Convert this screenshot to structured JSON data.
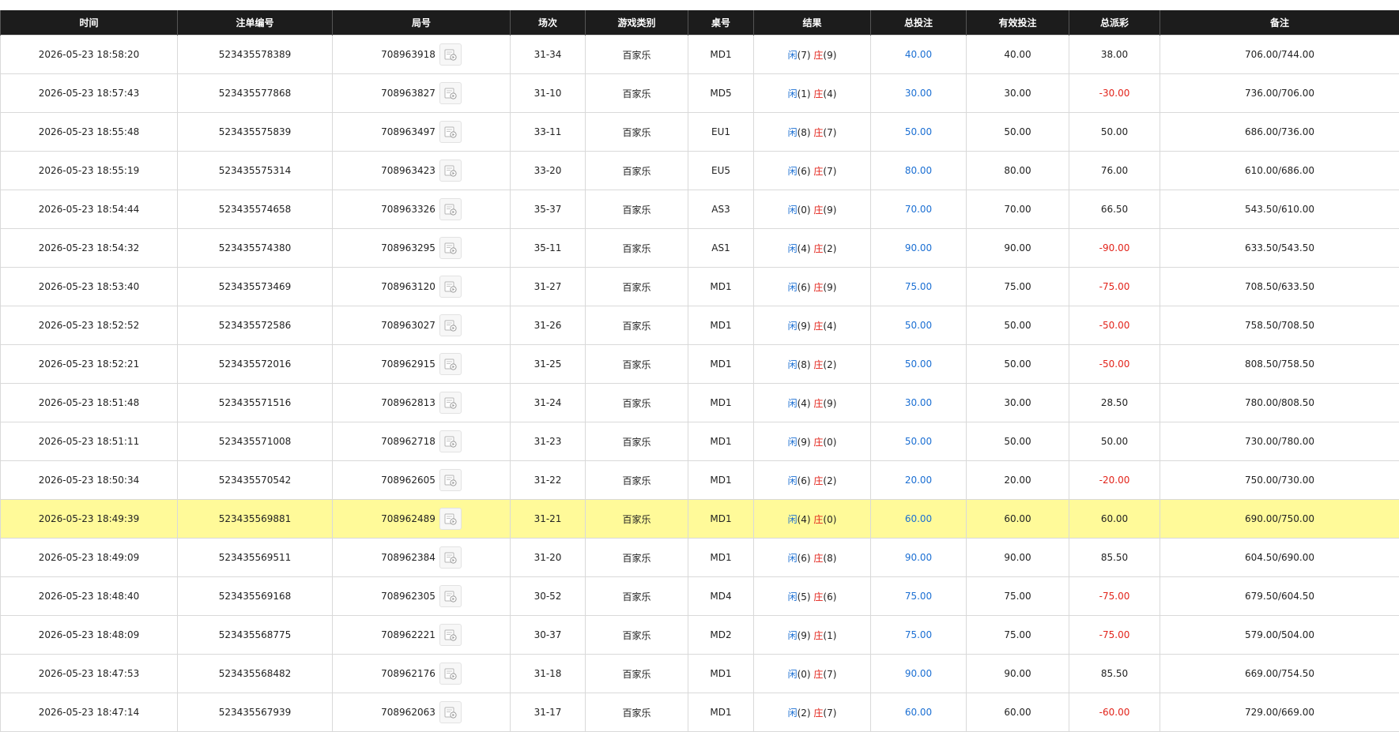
{
  "columns": [
    "时间",
    "注单编号",
    "局号",
    "场次",
    "游戏类别",
    "桌号",
    "结果",
    "总投注",
    "有效投注",
    "总派彩",
    "备注"
  ],
  "player_label": "闲",
  "banker_label": "庄",
  "highlight_row": 12,
  "colors": {
    "header_bg": "#1c1c1c",
    "highlight_bg": "#fffa99",
    "blue": "#1b6fd3",
    "red": "#e2231a"
  },
  "rows": [
    {
      "time": "2026-05-23 18:58:20",
      "bet_id": "523435578389",
      "round": "708963918",
      "shoe": "31-34",
      "game": "百家乐",
      "table": "MD1",
      "player": "(7)",
      "banker": "(9)",
      "total_bet": "40.00",
      "valid_bet": "40.00",
      "payout": "38.00",
      "payout_negative": false,
      "note": "706.00/744.00"
    },
    {
      "time": "2026-05-23 18:57:43",
      "bet_id": "523435577868",
      "round": "708963827",
      "shoe": "31-10",
      "game": "百家乐",
      "table": "MD5",
      "player": "(1)",
      "banker": "(4)",
      "total_bet": "30.00",
      "valid_bet": "30.00",
      "payout": "-30.00",
      "payout_negative": true,
      "note": "736.00/706.00"
    },
    {
      "time": "2026-05-23 18:55:48",
      "bet_id": "523435575839",
      "round": "708963497",
      "shoe": "33-11",
      "game": "百家乐",
      "table": "EU1",
      "player": "(8)",
      "banker": "(7)",
      "total_bet": "50.00",
      "valid_bet": "50.00",
      "payout": "50.00",
      "payout_negative": false,
      "note": "686.00/736.00"
    },
    {
      "time": "2026-05-23 18:55:19",
      "bet_id": "523435575314",
      "round": "708963423",
      "shoe": "33-20",
      "game": "百家乐",
      "table": "EU5",
      "player": "(6)",
      "banker": "(7)",
      "total_bet": "80.00",
      "valid_bet": "80.00",
      "payout": "76.00",
      "payout_negative": false,
      "note": "610.00/686.00"
    },
    {
      "time": "2026-05-23 18:54:44",
      "bet_id": "523435574658",
      "round": "708963326",
      "shoe": "35-37",
      "game": "百家乐",
      "table": "AS3",
      "player": "(0)",
      "banker": "(9)",
      "total_bet": "70.00",
      "valid_bet": "70.00",
      "payout": "66.50",
      "payout_negative": false,
      "note": "543.50/610.00"
    },
    {
      "time": "2026-05-23 18:54:32",
      "bet_id": "523435574380",
      "round": "708963295",
      "shoe": "35-11",
      "game": "百家乐",
      "table": "AS1",
      "player": "(4)",
      "banker": "(2)",
      "total_bet": "90.00",
      "valid_bet": "90.00",
      "payout": "-90.00",
      "payout_negative": true,
      "note": "633.50/543.50"
    },
    {
      "time": "2026-05-23 18:53:40",
      "bet_id": "523435573469",
      "round": "708963120",
      "shoe": "31-27",
      "game": "百家乐",
      "table": "MD1",
      "player": "(6)",
      "banker": "(9)",
      "total_bet": "75.00",
      "valid_bet": "75.00",
      "payout": "-75.00",
      "payout_negative": true,
      "note": "708.50/633.50"
    },
    {
      "time": "2026-05-23 18:52:52",
      "bet_id": "523435572586",
      "round": "708963027",
      "shoe": "31-26",
      "game": "百家乐",
      "table": "MD1",
      "player": "(9)",
      "banker": "(4)",
      "total_bet": "50.00",
      "valid_bet": "50.00",
      "payout": "-50.00",
      "payout_negative": true,
      "note": "758.50/708.50"
    },
    {
      "time": "2026-05-23 18:52:21",
      "bet_id": "523435572016",
      "round": "708962915",
      "shoe": "31-25",
      "game": "百家乐",
      "table": "MD1",
      "player": "(8)",
      "banker": "(2)",
      "total_bet": "50.00",
      "valid_bet": "50.00",
      "payout": "-50.00",
      "payout_negative": true,
      "note": "808.50/758.50"
    },
    {
      "time": "2026-05-23 18:51:48",
      "bet_id": "523435571516",
      "round": "708962813",
      "shoe": "31-24",
      "game": "百家乐",
      "table": "MD1",
      "player": "(4)",
      "banker": "(9)",
      "total_bet": "30.00",
      "valid_bet": "30.00",
      "payout": "28.50",
      "payout_negative": false,
      "note": "780.00/808.50"
    },
    {
      "time": "2026-05-23 18:51:11",
      "bet_id": "523435571008",
      "round": "708962718",
      "shoe": "31-23",
      "game": "百家乐",
      "table": "MD1",
      "player": "(9)",
      "banker": "(0)",
      "total_bet": "50.00",
      "valid_bet": "50.00",
      "payout": "50.00",
      "payout_negative": false,
      "note": "730.00/780.00"
    },
    {
      "time": "2026-05-23 18:50:34",
      "bet_id": "523435570542",
      "round": "708962605",
      "shoe": "31-22",
      "game": "百家乐",
      "table": "MD1",
      "player": "(6)",
      "banker": "(2)",
      "total_bet": "20.00",
      "valid_bet": "20.00",
      "payout": "-20.00",
      "payout_negative": true,
      "note": "750.00/730.00"
    },
    {
      "time": "2026-05-23 18:49:39",
      "bet_id": "523435569881",
      "round": "708962489",
      "shoe": "31-21",
      "game": "百家乐",
      "table": "MD1",
      "player": "(4)",
      "banker": "(0)",
      "total_bet": "60.00",
      "valid_bet": "60.00",
      "payout": "60.00",
      "payout_negative": false,
      "note": "690.00/750.00"
    },
    {
      "time": "2026-05-23 18:49:09",
      "bet_id": "523435569511",
      "round": "708962384",
      "shoe": "31-20",
      "game": "百家乐",
      "table": "MD1",
      "player": "(6)",
      "banker": "(8)",
      "total_bet": "90.00",
      "valid_bet": "90.00",
      "payout": "85.50",
      "payout_negative": false,
      "note": "604.50/690.00"
    },
    {
      "time": "2026-05-23 18:48:40",
      "bet_id": "523435569168",
      "round": "708962305",
      "shoe": "30-52",
      "game": "百家乐",
      "table": "MD4",
      "player": "(5)",
      "banker": "(6)",
      "total_bet": "75.00",
      "valid_bet": "75.00",
      "payout": "-75.00",
      "payout_negative": true,
      "note": "679.50/604.50"
    },
    {
      "time": "2026-05-23 18:48:09",
      "bet_id": "523435568775",
      "round": "708962221",
      "shoe": "30-37",
      "game": "百家乐",
      "table": "MD2",
      "player": "(9)",
      "banker": "(1)",
      "total_bet": "75.00",
      "valid_bet": "75.00",
      "payout": "-75.00",
      "payout_negative": true,
      "note": "579.00/504.00"
    },
    {
      "time": "2026-05-23 18:47:53",
      "bet_id": "523435568482",
      "round": "708962176",
      "shoe": "31-18",
      "game": "百家乐",
      "table": "MD1",
      "player": "(0)",
      "banker": "(7)",
      "total_bet": "90.00",
      "valid_bet": "90.00",
      "payout": "85.50",
      "payout_negative": false,
      "note": "669.00/754.50"
    },
    {
      "time": "2026-05-23 18:47:14",
      "bet_id": "523435567939",
      "round": "708962063",
      "shoe": "31-17",
      "game": "百家乐",
      "table": "MD1",
      "player": "(2)",
      "banker": "(7)",
      "total_bet": "60.00",
      "valid_bet": "60.00",
      "payout": "-60.00",
      "payout_negative": true,
      "note": "729.00/669.00"
    }
  ]
}
